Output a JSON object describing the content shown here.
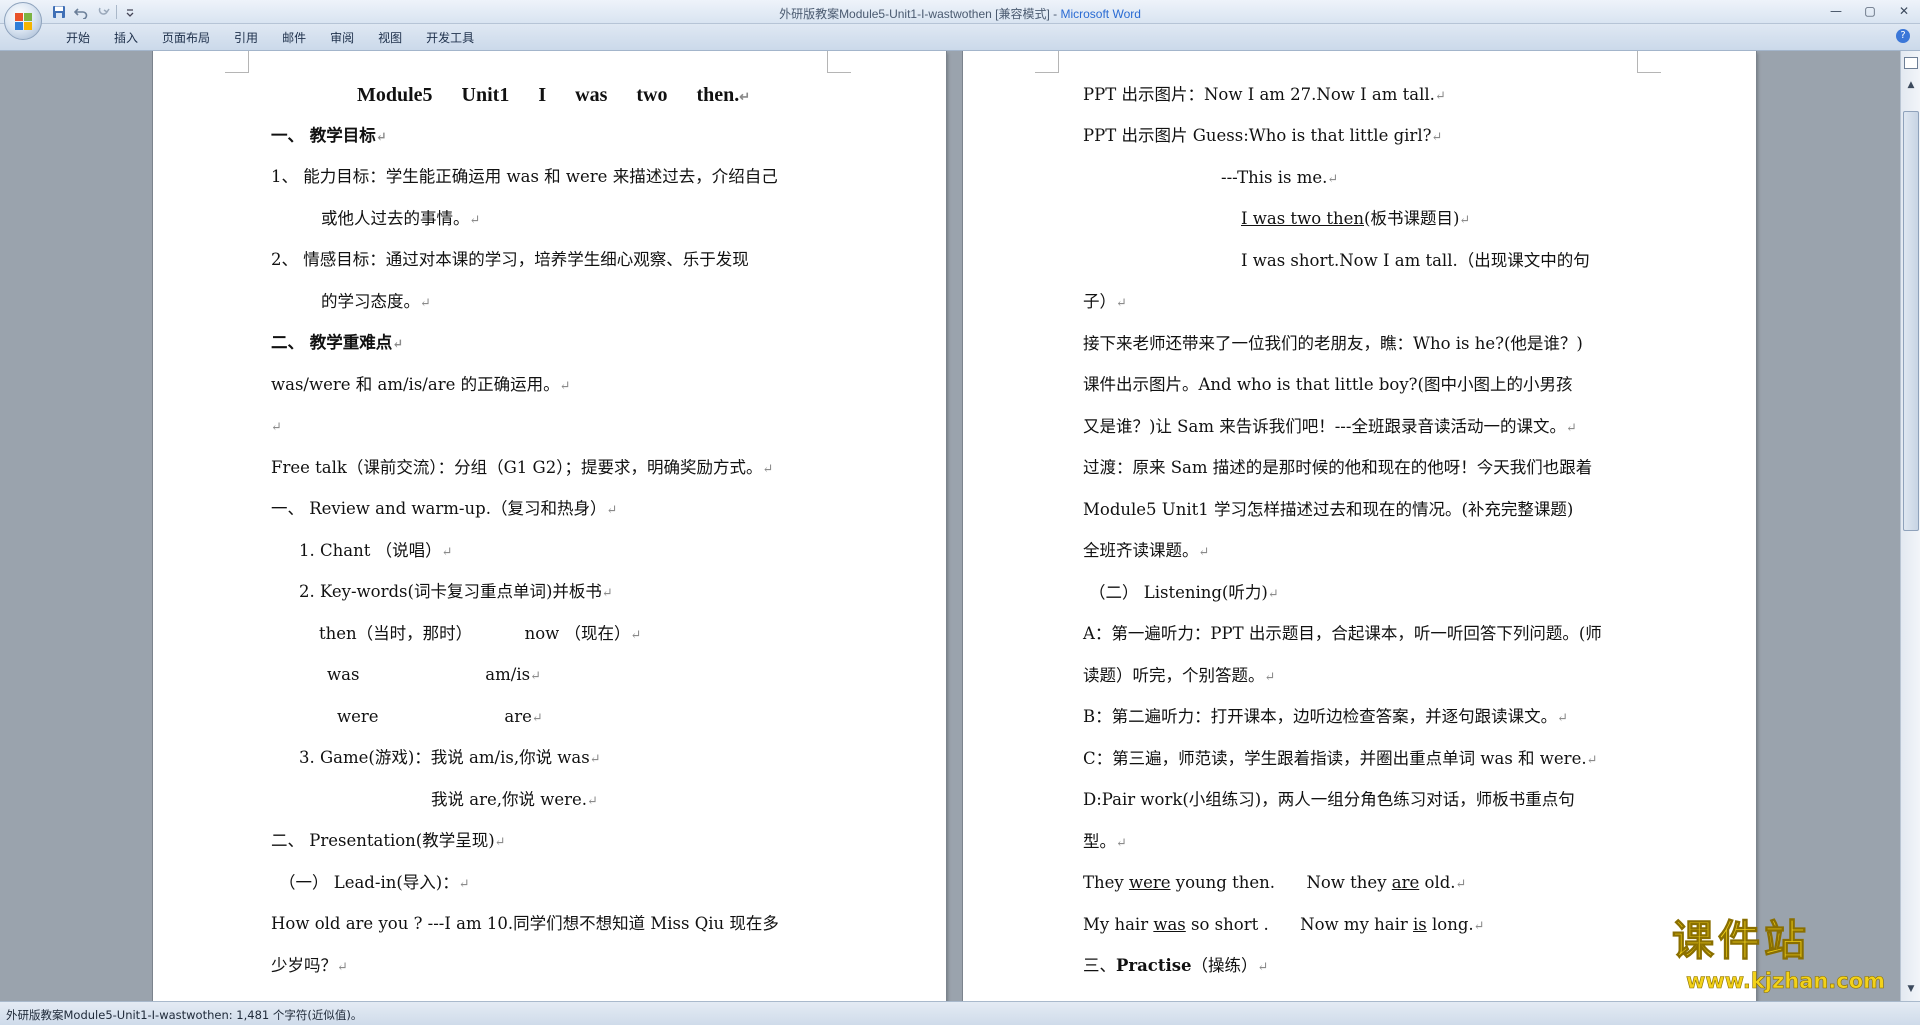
{
  "window": {
    "title_doc": "外研版教案Module5-Unit1-I-wastwothen [兼容模式] - ",
    "title_app": "Microsoft Word",
    "min_symbol": "—",
    "max_symbol": "▢",
    "close_symbol": "✕"
  },
  "ribbon": {
    "tabs": [
      "开始",
      "插入",
      "页面布局",
      "引用",
      "邮件",
      "审阅",
      "视图",
      "开发工具"
    ],
    "help": "?"
  },
  "page1": {
    "title": "Module5 Unit1 I was two then.",
    "lines": [
      "一、  教学目标",
      "1、    能力目标：学生能正确运用 was 和 were 来描述过去，介绍自己",
      "或他人过去的事情。",
      "2、    情感目标：通过对本课的学习，培养学生细心观察、乐于发现",
      "的学习态度。",
      "二、  教学重难点",
      "was/were 和 am/is/are 的正确运用。",
      "",
      "Free  talk（课前交流）：分组（G1  G2）；提要求，明确奖励方式。",
      "一、  Review and warm-up.（复习和热身）",
      "1. Chant （说唱）",
      "2. Key-words(词卡复习重点单词)并板书",
      "then（当时，那时）          now （现在）",
      "was                        am/is",
      "were                        are",
      "3. Game(游戏)：我说 am/is,你说 was",
      "我说 are,你说 were.",
      "二、  Presentation(教学呈现)",
      "（一）   Lead-in(导入)：",
      "How old are you ? ---I am 10.同学们想不想知道 Miss Qiu 现在多",
      "少岁吗？"
    ]
  },
  "page2": {
    "lines": [
      "PPT 出示图片：Now I am 27.Now I am tall.",
      "PPT 出示图片 Guess:Who is that little girl?",
      "---This is me.",
      "I was two then",
      "(板书课题目)",
      "I was short.Now I am tall.（出现课文中的句",
      "子）",
      "接下来老师还带来了一位我们的老朋友，瞧：Who is he?(他是谁？)",
      "课件出示图片。And who is that little boy?(图中小图上的小男孩",
      "又是谁？)让 Sam 来告诉我们吧！---全班跟录音读活动一的课文。",
      "过渡：原来 Sam 描述的是那时候的他和现在的他呀！今天我们也跟着",
      "Module5  Unit1 学习怎样描述过去和现在的情况。(补充完整课题)",
      "全班齐读课题。",
      "（二）  Listening(听力)",
      "A：第一遍听力：PPT 出示题目，合起课本，听一听回答下列问题。(师",
      "读题）听完，个别答题。",
      "B：第二遍听力：打开课本，边听边检查答案，并逐句跟读课文。",
      "C：第三遍，师范读，学生跟着指读，并圈出重点单词 was 和 were.",
      "D:Pair work(小组练习)，两人一组分角色练习对话，师板书重点句",
      "型。",
      "They ",
      "were",
      " young then.      Now they ",
      "are",
      " old.",
      "My hair ",
      "was",
      " so short .      Now my hair ",
      "is",
      " long.",
      "三、",
      "Practise",
      "（操练）"
    ]
  },
  "mark": "↵",
  "status": "外研版教案Module5-Unit1-I-wastwothen: 1,481 个字符(近似值)。",
  "watermark": {
    "main": "课件站",
    "url": "www.kjzhan.com"
  },
  "scrollbar": {
    "up": "▲",
    "down": "▼"
  }
}
